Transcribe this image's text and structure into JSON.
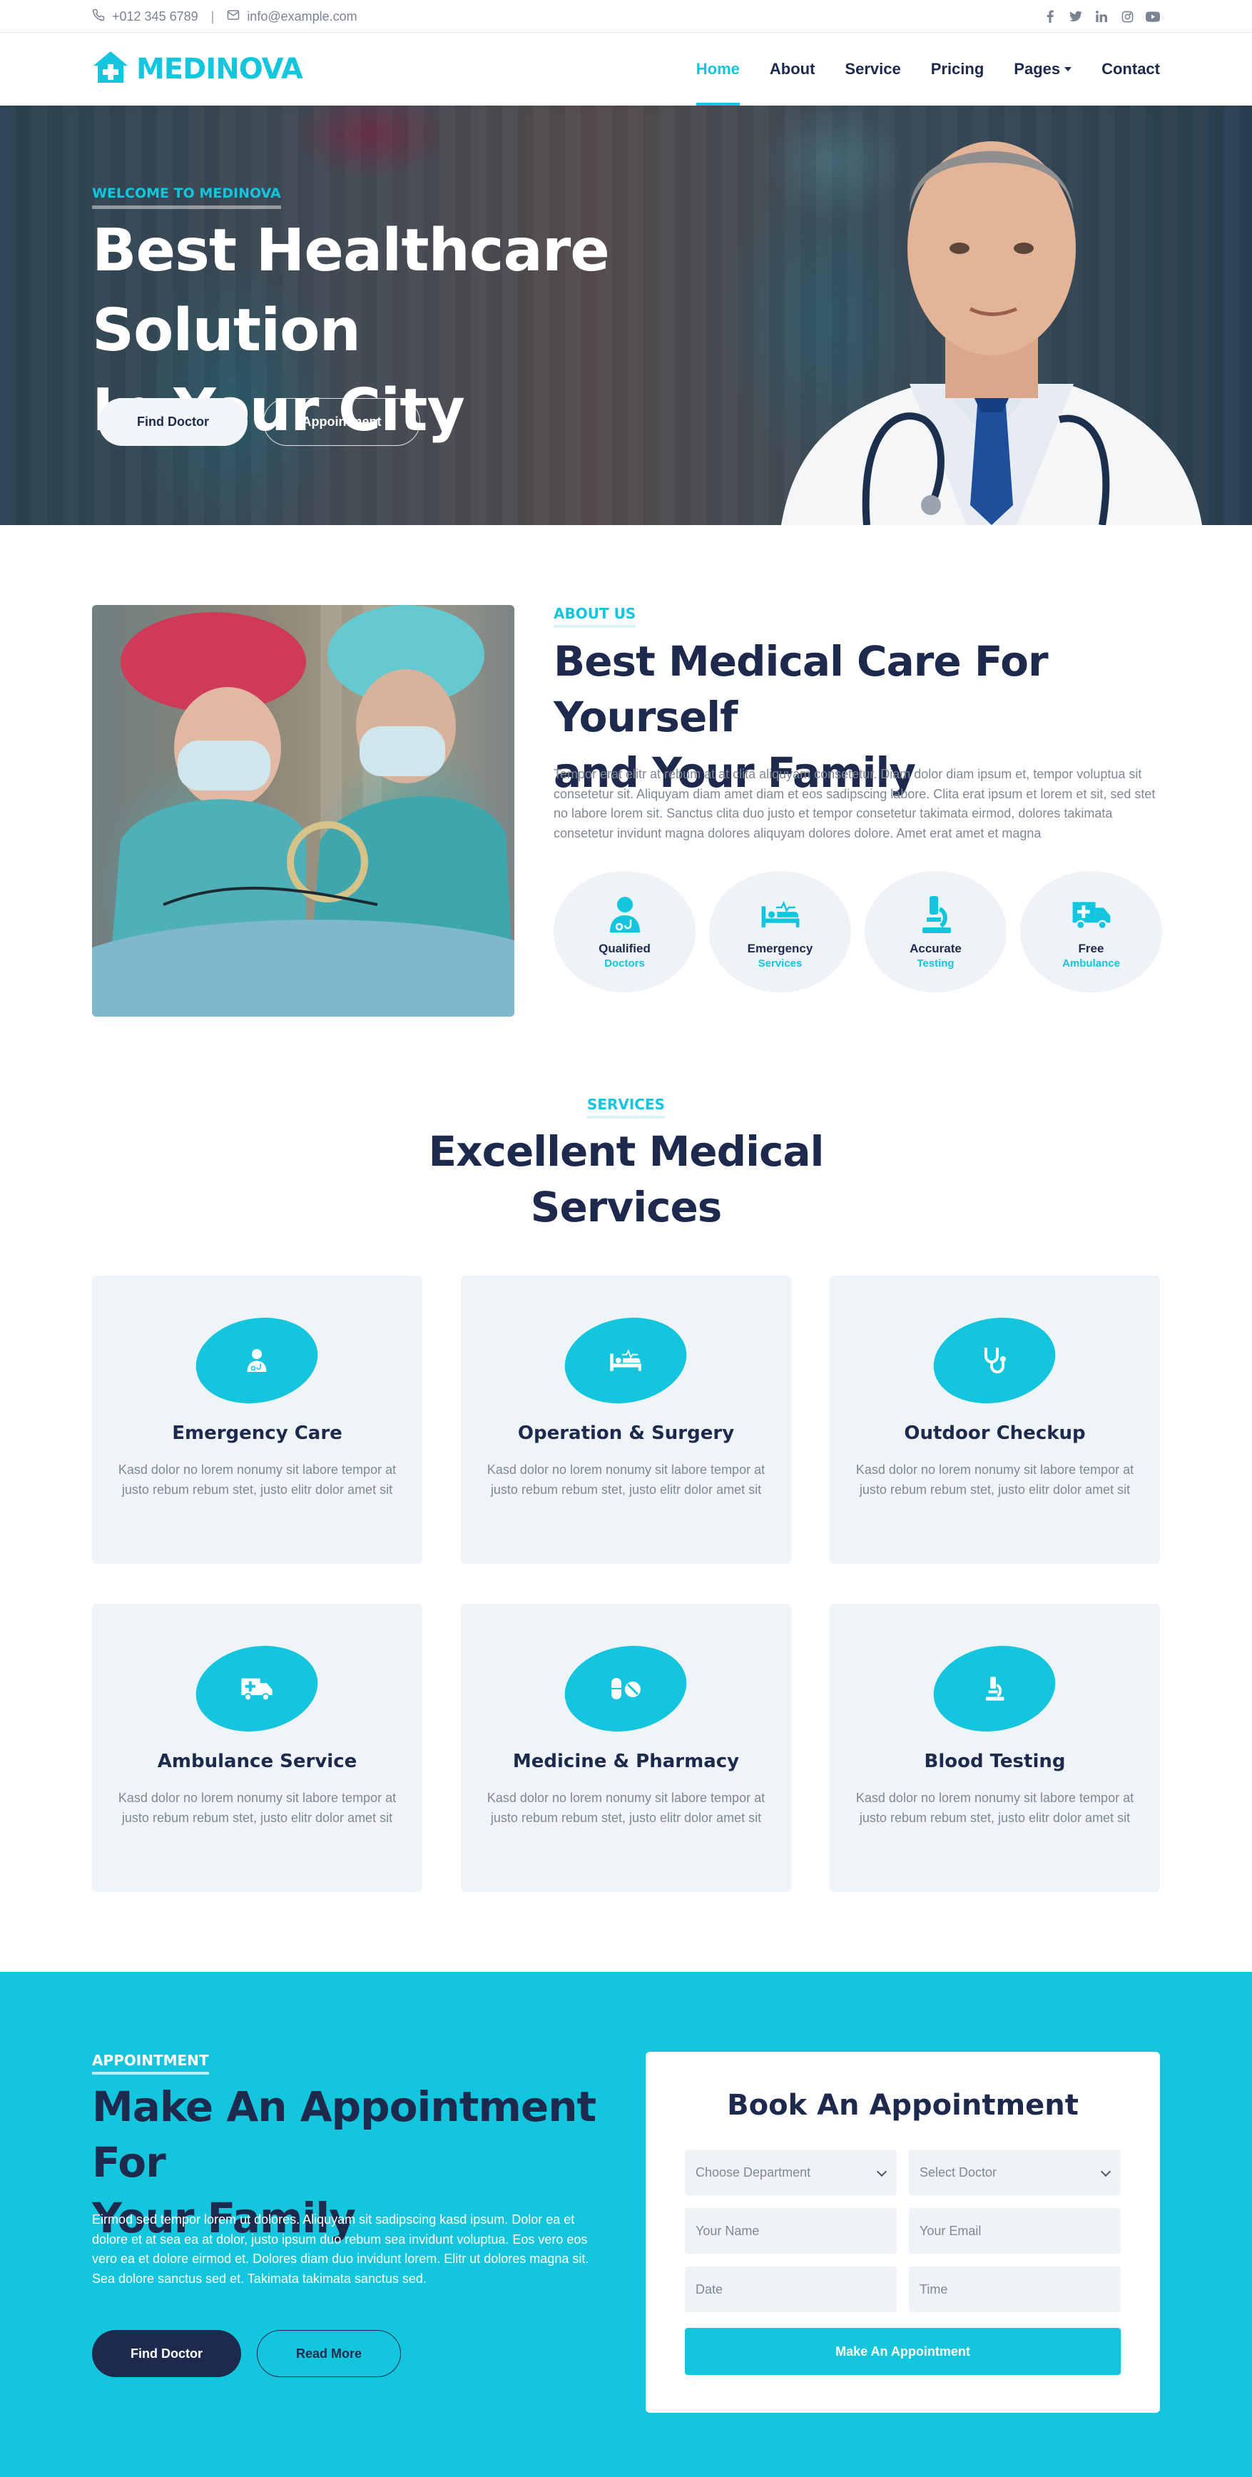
{
  "topbar": {
    "phone": "+012 345 6789",
    "separator": "|",
    "email": "info@example.com",
    "social_icons": [
      "facebook-icon",
      "twitter-icon",
      "linkedin-icon",
      "instagram-icon",
      "youtube-icon"
    ]
  },
  "nav": {
    "brand": "MEDINOVA",
    "items": [
      {
        "label": "Home",
        "active": true
      },
      {
        "label": "About"
      },
      {
        "label": "Service"
      },
      {
        "label": "Pricing"
      },
      {
        "label": "Pages",
        "dropdown": true
      },
      {
        "label": "Contact"
      }
    ]
  },
  "hero": {
    "eyebrow": "WELCOME TO MEDINOVA",
    "title_line1": "Best Healthcare Solution",
    "title_line2": "In Your City",
    "primary_button": "Find Doctor",
    "secondary_button": "Appointment"
  },
  "about": {
    "eyebrow": "ABOUT US",
    "title_line1": "Best Medical Care For Yourself",
    "title_line2": "and Your Family",
    "text": "Tempor erat elitr at rebum at at clita aliquyam consetetur. Diam dolor diam ipsum et, tempor voluptua sit consetetur sit. Aliquyam diam amet diam et eos sadipscing labore. Clita erat ipsum et lorem et sit, sed stet no labore lorem sit. Sanctus clita duo justo et tempor consetetur takimata eirmod, dolores takimata consetetur invidunt magna dolores aliquyam dolores dolore. Amet erat amet et magna",
    "features": [
      {
        "title": "Qualified",
        "subtitle": "Doctors",
        "icon": "doctor-icon"
      },
      {
        "title": "Emergency",
        "subtitle": "Services",
        "icon": "bed-pulse-icon"
      },
      {
        "title": "Accurate",
        "subtitle": "Testing",
        "icon": "microscope-icon"
      },
      {
        "title": "Free",
        "subtitle": "Ambulance",
        "icon": "ambulance-icon"
      }
    ]
  },
  "services": {
    "eyebrow": "SERVICES",
    "title_line1": "Excellent Medical",
    "title_line2": "Services",
    "items": [
      {
        "title": "Emergency Care",
        "desc": "Kasd dolor no lorem nonumy sit labore tempor at justo rebum rebum stet, justo elitr dolor amet sit",
        "icon": "doctor-icon"
      },
      {
        "title": "Operation & Surgery",
        "desc": "Kasd dolor no lorem nonumy sit labore tempor at justo rebum rebum stet, justo elitr dolor amet sit",
        "icon": "bed-pulse-icon"
      },
      {
        "title": "Outdoor Checkup",
        "desc": "Kasd dolor no lorem nonumy sit labore tempor at justo rebum rebum stet, justo elitr dolor amet sit",
        "icon": "stethoscope-icon"
      },
      {
        "title": "Ambulance Service",
        "desc": "Kasd dolor no lorem nonumy sit labore tempor at justo rebum rebum stet, justo elitr dolor amet sit",
        "icon": "ambulance-icon"
      },
      {
        "title": "Medicine & Pharmacy",
        "desc": "Kasd dolor no lorem nonumy sit labore tempor at justo rebum rebum stet, justo elitr dolor amet sit",
        "icon": "pills-icon"
      },
      {
        "title": "Blood Testing",
        "desc": "Kasd dolor no lorem nonumy sit labore tempor at justo rebum rebum stet, justo elitr dolor amet sit",
        "icon": "microscope-icon"
      }
    ]
  },
  "appointment": {
    "eyebrow": "APPOINTMENT",
    "title_line1": "Make An Appointment For",
    "title_line2": "Your Family",
    "text": "Eirmod sed tempor lorem ut dolores. Aliquyam sit sadipscing kasd ipsum. Dolor ea et dolore et at sea ea at dolor, justo ipsum duo rebum sea invidunt voluptua. Eos vero eos vero ea et dolore eirmod et. Dolores diam duo invidunt lorem. Elitr ut dolores magna sit. Sea dolore sanctus sed et. Takimata takimata sanctus sed.",
    "primary_button": "Find Doctor",
    "secondary_button": "Read More",
    "form": {
      "title": "Book An Appointment",
      "department": "Choose Department",
      "doctor": "Select Doctor",
      "name_placeholder": "Your Name",
      "email_placeholder": "Your Email",
      "date_placeholder": "Date",
      "time_placeholder": "Time",
      "submit": "Make An Appointment"
    }
  },
  "colors": {
    "accent": "#13c5dd",
    "dark": "#1d2a4d",
    "light_bg": "#eff4f8",
    "muted_text": "#7f8893"
  }
}
